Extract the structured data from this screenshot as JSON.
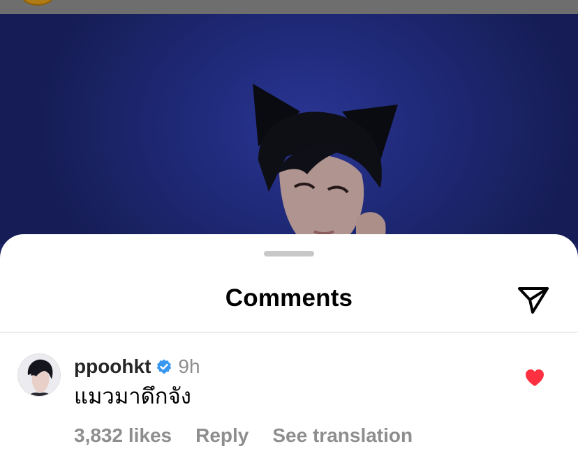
{
  "sheet": {
    "title": "Comments",
    "share_icon": "send-paper-plane-icon"
  },
  "comment": {
    "username": "ppoohkt",
    "verified_icon": "verified-badge-icon",
    "time": "9h",
    "text": "แมวมาดึกจัง",
    "likes": "3,832 likes",
    "reply_label": "Reply",
    "translate_label": "See translation",
    "liked": true,
    "like_icon": "heart-filled-icon"
  },
  "colors": {
    "like_red": "#ff3040",
    "verified_blue": "#3897f0",
    "muted_text": "#8e8e8e",
    "photo_bg": "#2a3596"
  }
}
